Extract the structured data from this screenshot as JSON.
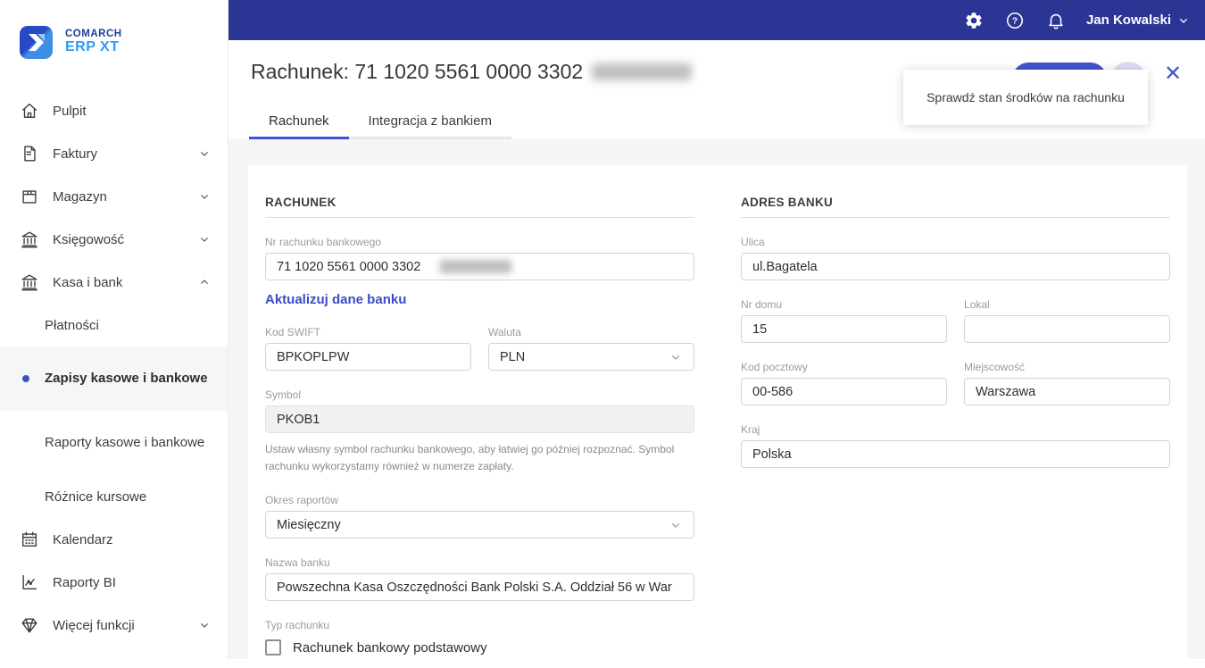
{
  "brand": {
    "line1": "COMARCH",
    "line2": "ERP XT"
  },
  "topbar": {
    "user_name": "Jan Kowalski"
  },
  "sidebar": {
    "pulpit": "Pulpit",
    "faktury": "Faktury",
    "magazyn": "Magazyn",
    "ksiegowosc": "Księgowość",
    "kasa_i_bank": "Kasa i bank",
    "platnosci": "Płatności",
    "zapisy": "Zapisy kasowe i bankowe",
    "raporty_kb": "Raporty kasowe i bankowe",
    "roznice": "Różnice kursowe",
    "kalendarz": "Kalendarz",
    "raporty_bi": "Raporty BI",
    "wiecej": "Więcej funkcji"
  },
  "header": {
    "title": "Rachunek: 71 1020 5561 0000 3302",
    "tab1": "Rachunek",
    "tab2": "Integracja z bankiem",
    "tooltip": "Sprawdź stan środków na rachunku",
    "close": "✕"
  },
  "form": {
    "section1_title": "RACHUNEK",
    "nr_label": "Nr rachunku bankowego",
    "nr_value": "71 1020 5561 0000 3302",
    "update_link": "Aktualizuj dane banku",
    "swift_label": "Kod SWIFT",
    "swift_value": "BPKOPLPW",
    "waluta_label": "Waluta",
    "waluta_value": "PLN",
    "symbol_label": "Symbol",
    "symbol_value": "PKOB1",
    "symbol_help": "Ustaw własny symbol rachunku bankowego, aby łatwiej go później rozpoznać. Symbol rachunku wykorzystamy również w numerze zapłaty.",
    "okres_label": "Okres raportów",
    "okres_value": "Miesięczny",
    "nazwa_label": "Nazwa banku",
    "nazwa_value": "Powszechna Kasa Oszczędności Bank Polski S.A. Oddział 56 w War",
    "typ_label": "Typ rachunku",
    "typ_checkbox_label": "Rachunek bankowy podstawowy",
    "section2_title": "ADRES BANKU",
    "ulica_label": "Ulica",
    "ulica_value": "ul.Bagatela",
    "nrdomu_label": "Nr domu",
    "nrdomu_value": "15",
    "lokal_label": "Lokal",
    "lokal_value": "",
    "kodpocztowy_label": "Kod pocztowy",
    "kodpocztowy_value": "00-586",
    "miejscowosc_label": "Miejscowość",
    "miejscowosc_value": "Warszawa",
    "kraj_label": "Kraj",
    "kraj_value": "Polska"
  },
  "colors": {
    "topbar": "#2b3594",
    "accent_button": "#4353cb",
    "accent_link": "#3c4bc8",
    "tab_underline": "#4150d8",
    "active_dot": "#3d52cc",
    "content_bg": "#f4f5f7"
  }
}
